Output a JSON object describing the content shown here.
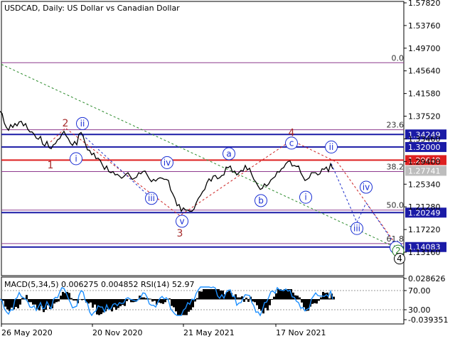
{
  "chart_data": {
    "type": "line",
    "title": "USDCAD, Daily:  US Dollar vs Canadian Dollar",
    "symbol": "USDCAD",
    "timeframe": "Daily",
    "description": "US Dollar vs Canadian Dollar",
    "ylim": [
      1.11,
      1.582
    ],
    "price_ticks": [
      "1.57820",
      "1.53760",
      "1.49700",
      "1.45640",
      "1.41580",
      "1.37520",
      "1.33460",
      "1.29400",
      "1.25340",
      "1.21280",
      "1.17220",
      "1.13160"
    ],
    "date_ticks": [
      "26 May 2020",
      "20 Nov 2020",
      "21 May 2021",
      "17 Nov 2021"
    ],
    "horizontal_levels": [
      {
        "price": 1.34249,
        "label": "1.34249",
        "color": "#1a1aa6"
      },
      {
        "price": 1.32,
        "label": "1.32000",
        "color": "#1a1aa6"
      },
      {
        "price": 1.29648,
        "label": "1.29648",
        "color": "#dd1f1f"
      },
      {
        "price": 1.27741,
        "label": "1.27741",
        "color": "#cccccc"
      },
      {
        "price": 1.20249,
        "label": "1.20249",
        "color": "#1a1aa6"
      },
      {
        "price": 1.14083,
        "label": "1.14083",
        "color": "#1a1aa6"
      }
    ],
    "fib_levels": [
      {
        "label": "0.0",
        "price": 1.471
      },
      {
        "label": "23.6",
        "price": 1.351
      },
      {
        "label": "38.2",
        "price": 1.276
      },
      {
        "label": "50.0",
        "price": 1.207
      },
      {
        "label": "61.8",
        "price": 1.147
      }
    ],
    "price_series": [
      [
        0,
        1.384
      ],
      [
        3,
        1.38
      ],
      [
        6,
        1.363
      ],
      [
        9,
        1.355
      ],
      [
        12,
        1.35
      ],
      [
        15,
        1.36
      ],
      [
        18,
        1.355
      ],
      [
        21,
        1.362
      ],
      [
        24,
        1.358
      ],
      [
        27,
        1.365
      ],
      [
        30,
        1.366
      ],
      [
        33,
        1.358
      ],
      [
        36,
        1.362
      ],
      [
        39,
        1.352
      ],
      [
        42,
        1.347
      ],
      [
        45,
        1.347
      ],
      [
        48,
        1.343
      ],
      [
        51,
        1.336
      ],
      [
        54,
        1.334
      ],
      [
        57,
        1.339
      ],
      [
        60,
        1.325
      ],
      [
        63,
        1.322
      ],
      [
        66,
        1.33
      ],
      [
        69,
        1.319
      ],
      [
        72,
        1.317
      ],
      [
        75,
        1.324
      ],
      [
        78,
        1.326
      ],
      [
        81,
        1.333
      ],
      [
        84,
        1.335
      ],
      [
        87,
        1.343
      ],
      [
        90,
        1.348
      ],
      [
        93,
        1.34
      ],
      [
        96,
        1.335
      ],
      [
        99,
        1.327
      ],
      [
        102,
        1.323
      ],
      [
        105,
        1.33
      ],
      [
        108,
        1.324
      ],
      [
        111,
        1.343
      ],
      [
        114,
        1.346
      ],
      [
        117,
        1.339
      ],
      [
        120,
        1.326
      ],
      [
        123,
        1.315
      ],
      [
        126,
        1.314
      ],
      [
        129,
        1.306
      ],
      [
        132,
        1.309
      ],
      [
        135,
        1.299
      ],
      [
        138,
        1.3
      ],
      [
        141,
        1.296
      ],
      [
        144,
        1.288
      ],
      [
        147,
        1.28
      ],
      [
        150,
        1.286
      ],
      [
        153,
        1.276
      ],
      [
        156,
        1.274
      ],
      [
        159,
        1.276
      ],
      [
        162,
        1.27
      ],
      [
        165,
        1.271
      ],
      [
        168,
        1.268
      ],
      [
        171,
        1.264
      ],
      [
        174,
        1.267
      ],
      [
        177,
        1.271
      ],
      [
        180,
        1.274
      ],
      [
        183,
        1.268
      ],
      [
        186,
        1.262
      ],
      [
        189,
        1.264
      ],
      [
        192,
        1.266
      ],
      [
        195,
        1.274
      ],
      [
        198,
        1.272
      ],
      [
        201,
        1.276
      ],
      [
        204,
        1.277
      ],
      [
        207,
        1.27
      ],
      [
        210,
        1.263
      ],
      [
        213,
        1.258
      ],
      [
        216,
        1.262
      ],
      [
        219,
        1.259
      ],
      [
        222,
        1.263
      ],
      [
        225,
        1.265
      ],
      [
        228,
        1.264
      ],
      [
        231,
        1.262
      ],
      [
        234,
        1.262
      ],
      [
        237,
        1.26
      ],
      [
        240,
        1.243
      ],
      [
        243,
        1.236
      ],
      [
        246,
        1.228
      ],
      [
        249,
        1.215
      ],
      [
        252,
        1.217
      ],
      [
        255,
        1.205
      ],
      [
        258,
        1.211
      ],
      [
        261,
        1.207
      ],
      [
        264,
        1.207
      ],
      [
        267,
        1.205
      ],
      [
        270,
        1.205
      ],
      [
        273,
        1.209
      ],
      [
        276,
        1.22
      ],
      [
        279,
        1.228
      ],
      [
        282,
        1.233
      ],
      [
        285,
        1.24
      ],
      [
        288,
        1.244
      ],
      [
        291,
        1.256
      ],
      [
        294,
        1.263
      ],
      [
        297,
        1.259
      ],
      [
        300,
        1.268
      ],
      [
        303,
        1.269
      ],
      [
        306,
        1.263
      ],
      [
        309,
        1.265
      ],
      [
        312,
        1.269
      ],
      [
        315,
        1.27
      ],
      [
        318,
        1.284
      ],
      [
        321,
        1.283
      ],
      [
        324,
        1.286
      ],
      [
        327,
        1.275
      ],
      [
        330,
        1.277
      ],
      [
        333,
        1.27
      ],
      [
        336,
        1.274
      ],
      [
        339,
        1.278
      ],
      [
        342,
        1.277
      ],
      [
        345,
        1.287
      ],
      [
        348,
        1.279
      ],
      [
        351,
        1.282
      ],
      [
        354,
        1.271
      ],
      [
        357,
        1.262
      ],
      [
        360,
        1.257
      ],
      [
        363,
        1.25
      ],
      [
        366,
        1.244
      ],
      [
        369,
        1.246
      ],
      [
        372,
        1.254
      ],
      [
        375,
        1.25
      ],
      [
        378,
        1.254
      ],
      [
        381,
        1.261
      ],
      [
        384,
        1.264
      ],
      [
        387,
        1.267
      ],
      [
        390,
        1.276
      ],
      [
        393,
        1.275
      ],
      [
        396,
        1.281
      ],
      [
        399,
        1.283
      ],
      [
        402,
        1.29
      ],
      [
        405,
        1.294
      ],
      [
        408,
        1.295
      ],
      [
        411,
        1.286
      ],
      [
        414,
        1.287
      ],
      [
        417,
        1.285
      ],
      [
        420,
        1.286
      ],
      [
        423,
        1.274
      ],
      [
        426,
        1.267
      ],
      [
        429,
        1.26
      ],
      [
        432,
        1.262
      ],
      [
        435,
        1.265
      ],
      [
        438,
        1.274
      ],
      [
        441,
        1.274
      ],
      [
        444,
        1.274
      ],
      [
        447,
        1.27
      ],
      [
        450,
        1.272
      ],
      [
        453,
        1.281
      ],
      [
        456,
        1.28
      ],
      [
        459,
        1.284
      ],
      [
        462,
        1.276
      ],
      [
        465,
        1.29
      ],
      [
        468,
        1.281
      ]
    ],
    "wave_labels_red": [
      {
        "text": "2",
        "x": 92,
        "price": 1.363
      },
      {
        "text": "1",
        "x": 71,
        "price": 1.288
      },
      {
        "text": "3",
        "x": 253,
        "price": 1.166
      },
      {
        "text": "4",
        "x": 410,
        "price": 1.346
      }
    ],
    "wave_labels_circled": [
      {
        "text": "ii",
        "x": 116,
        "price": 1.362
      },
      {
        "text": "i",
        "x": 107,
        "price": 1.299
      },
      {
        "text": "iv",
        "x": 235,
        "price": 1.292
      },
      {
        "text": "iii",
        "x": 213,
        "price": 1.228
      },
      {
        "text": "v",
        "x": 256,
        "price": 1.187
      },
      {
        "text": "a",
        "x": 322,
        "price": 1.308
      },
      {
        "text": "b",
        "x": 367,
        "price": 1.224
      },
      {
        "text": "c",
        "x": 410,
        "price": 1.327
      },
      {
        "text": "i",
        "x": 430,
        "price": 1.23
      },
      {
        "text": "ii",
        "x": 466,
        "price": 1.32
      },
      {
        "text": "iv",
        "x": 515,
        "price": 1.248
      },
      {
        "text": "iii",
        "x": 502,
        "price": 1.174
      },
      {
        "text": "v",
        "x": 557,
        "price": 1.14
      }
    ],
    "wave_labels_green": [
      {
        "text": "2",
        "x": 560,
        "price": 1.134
      }
    ],
    "wave_labels_black_circled": [
      {
        "text": "4",
        "x": 562,
        "price": 1.12
      }
    ],
    "indicator": {
      "label": "MACD(5,34,5) 0.006275 0.004852 RSI(14) 52.97",
      "ticks": [
        "0.028626",
        "70.00",
        "30.00",
        "-0.039351"
      ]
    }
  }
}
